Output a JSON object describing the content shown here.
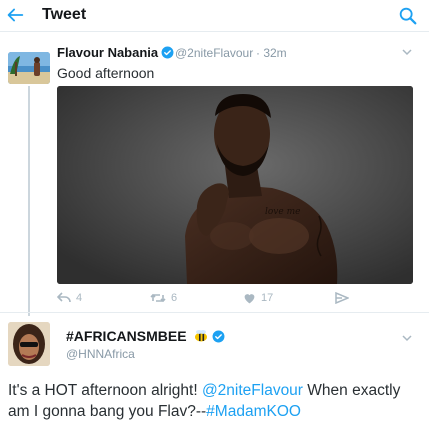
{
  "header": {
    "title": "Tweet",
    "back_icon": "back-arrow-icon",
    "search_icon": "search-icon"
  },
  "colors": {
    "accent": "#1da1f2",
    "secondary_text": "#8899a6",
    "divider": "#e6ecf0"
  },
  "tweet1": {
    "name": "Flavour Nabania",
    "handle": "@2niteFlavour",
    "time": "· 32m",
    "text": "Good afternoon",
    "reply_count": "4",
    "retweet_count": "6",
    "like_count": "17"
  },
  "tweet2": {
    "name": "#AFRICANSMBEE",
    "handle": "@HNNAfrica",
    "text_part1": "It's a HOT afternoon alright! ",
    "mention": "@2niteFlavour",
    "text_part2": " When exactly am I gonna bang you Flav?--",
    "hashtag": "#MadamKOO"
  }
}
